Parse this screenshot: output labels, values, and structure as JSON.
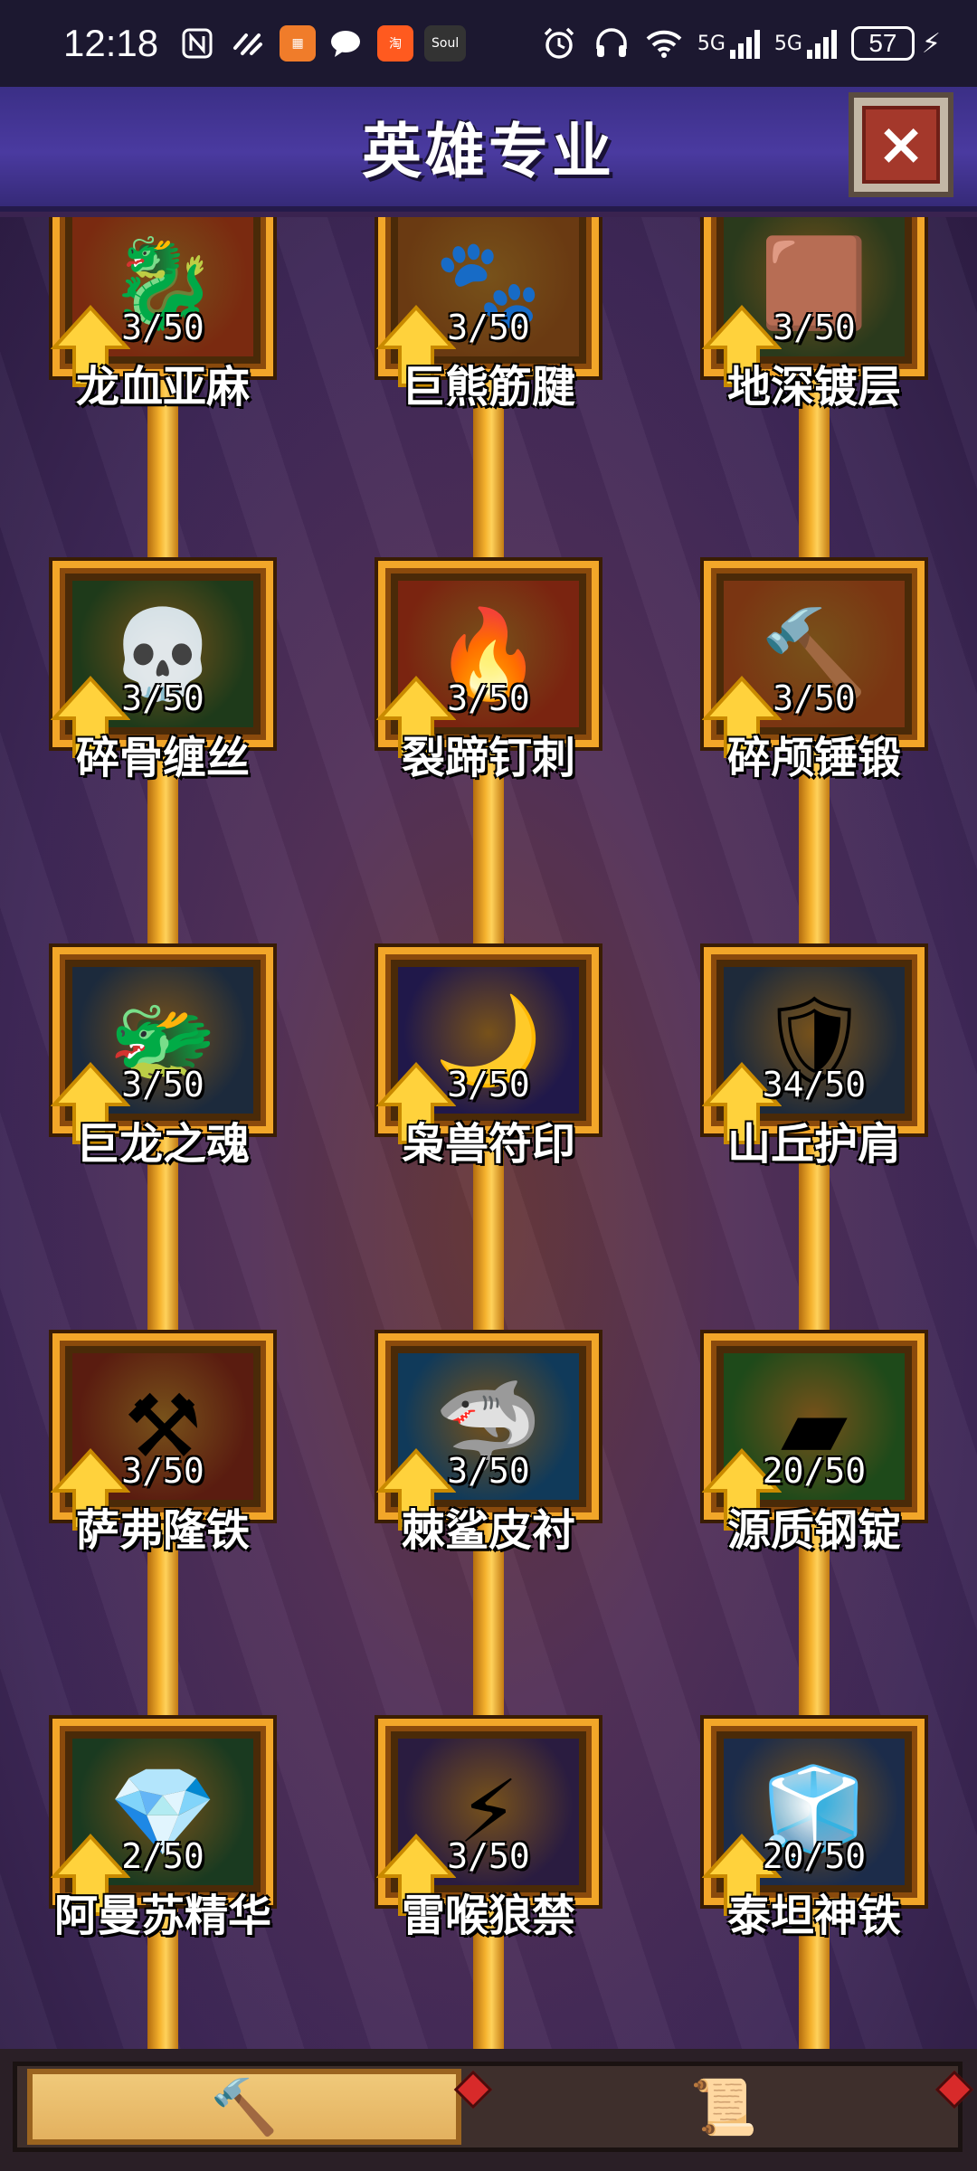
{
  "status_bar": {
    "time": "12:18",
    "apps": [
      "nfc-icon",
      "link-icon",
      "grid-app-icon",
      "chat-icon",
      "taobao-icon",
      "soul-icon"
    ],
    "soul_label": "Soul",
    "network_1": "5G",
    "network_2": "5G",
    "battery": "57"
  },
  "header": {
    "title": "英雄专业",
    "close_label": "×"
  },
  "skills": [
    {
      "name": "龙血亚麻",
      "count": "3/50",
      "art": "🐉",
      "bg": "#7a2a10"
    },
    {
      "name": "巨熊筋腱",
      "count": "3/50",
      "art": "🐾",
      "bg": "#6a3a12"
    },
    {
      "name": "地深镀层",
      "count": "3/50",
      "art": "🟫",
      "bg": "#2a3a1c"
    },
    {
      "name": "碎骨缠丝",
      "count": "3/50",
      "art": "💀",
      "bg": "#1e3a1a"
    },
    {
      "name": "裂蹄钉刺",
      "count": "3/50",
      "art": "🔥",
      "bg": "#7a2410"
    },
    {
      "name": "碎颅锤锻",
      "count": "3/50",
      "art": "🔨",
      "bg": "#7a3512"
    },
    {
      "name": "巨龙之魂",
      "count": "3/50",
      "art": "🐲",
      "bg": "#1c2a3c"
    },
    {
      "name": "枭兽符印",
      "count": "3/50",
      "art": "🌙",
      "bg": "#20184a"
    },
    {
      "name": "山丘护肩",
      "count": "34/50",
      "art": "🛡",
      "bg": "#1e2a3a"
    },
    {
      "name": "萨弗隆铁",
      "count": "3/50",
      "art": "⚒",
      "bg": "#5a1c10"
    },
    {
      "name": "棘鲨皮衬",
      "count": "3/50",
      "art": "🦈",
      "bg": "#103a5a"
    },
    {
      "name": "源质钢锭",
      "count": "20/50",
      "art": "▰",
      "bg": "#1e4a1a"
    },
    {
      "name": "阿曼苏精华",
      "count": "2/50",
      "art": "💎",
      "bg": "#1a3a20"
    },
    {
      "name": "雷喉狼禁",
      "count": "3/50",
      "art": "⚡",
      "bg": "#2a1c40"
    },
    {
      "name": "泰坦神铁",
      "count": "20/50",
      "art": "🧊",
      "bg": "#1c2c4a"
    }
  ],
  "bottom_nav": {
    "tabs": [
      {
        "name": "hammer-tab",
        "icon": "🔨",
        "active": true
      },
      {
        "name": "scroll-tab",
        "icon": "📜",
        "active": false
      }
    ]
  },
  "colors": {
    "gold_frame": "#f2a629",
    "arrow": "#ffd23c",
    "header_bg": "#3b2f86",
    "close_red": "#a4382b"
  }
}
